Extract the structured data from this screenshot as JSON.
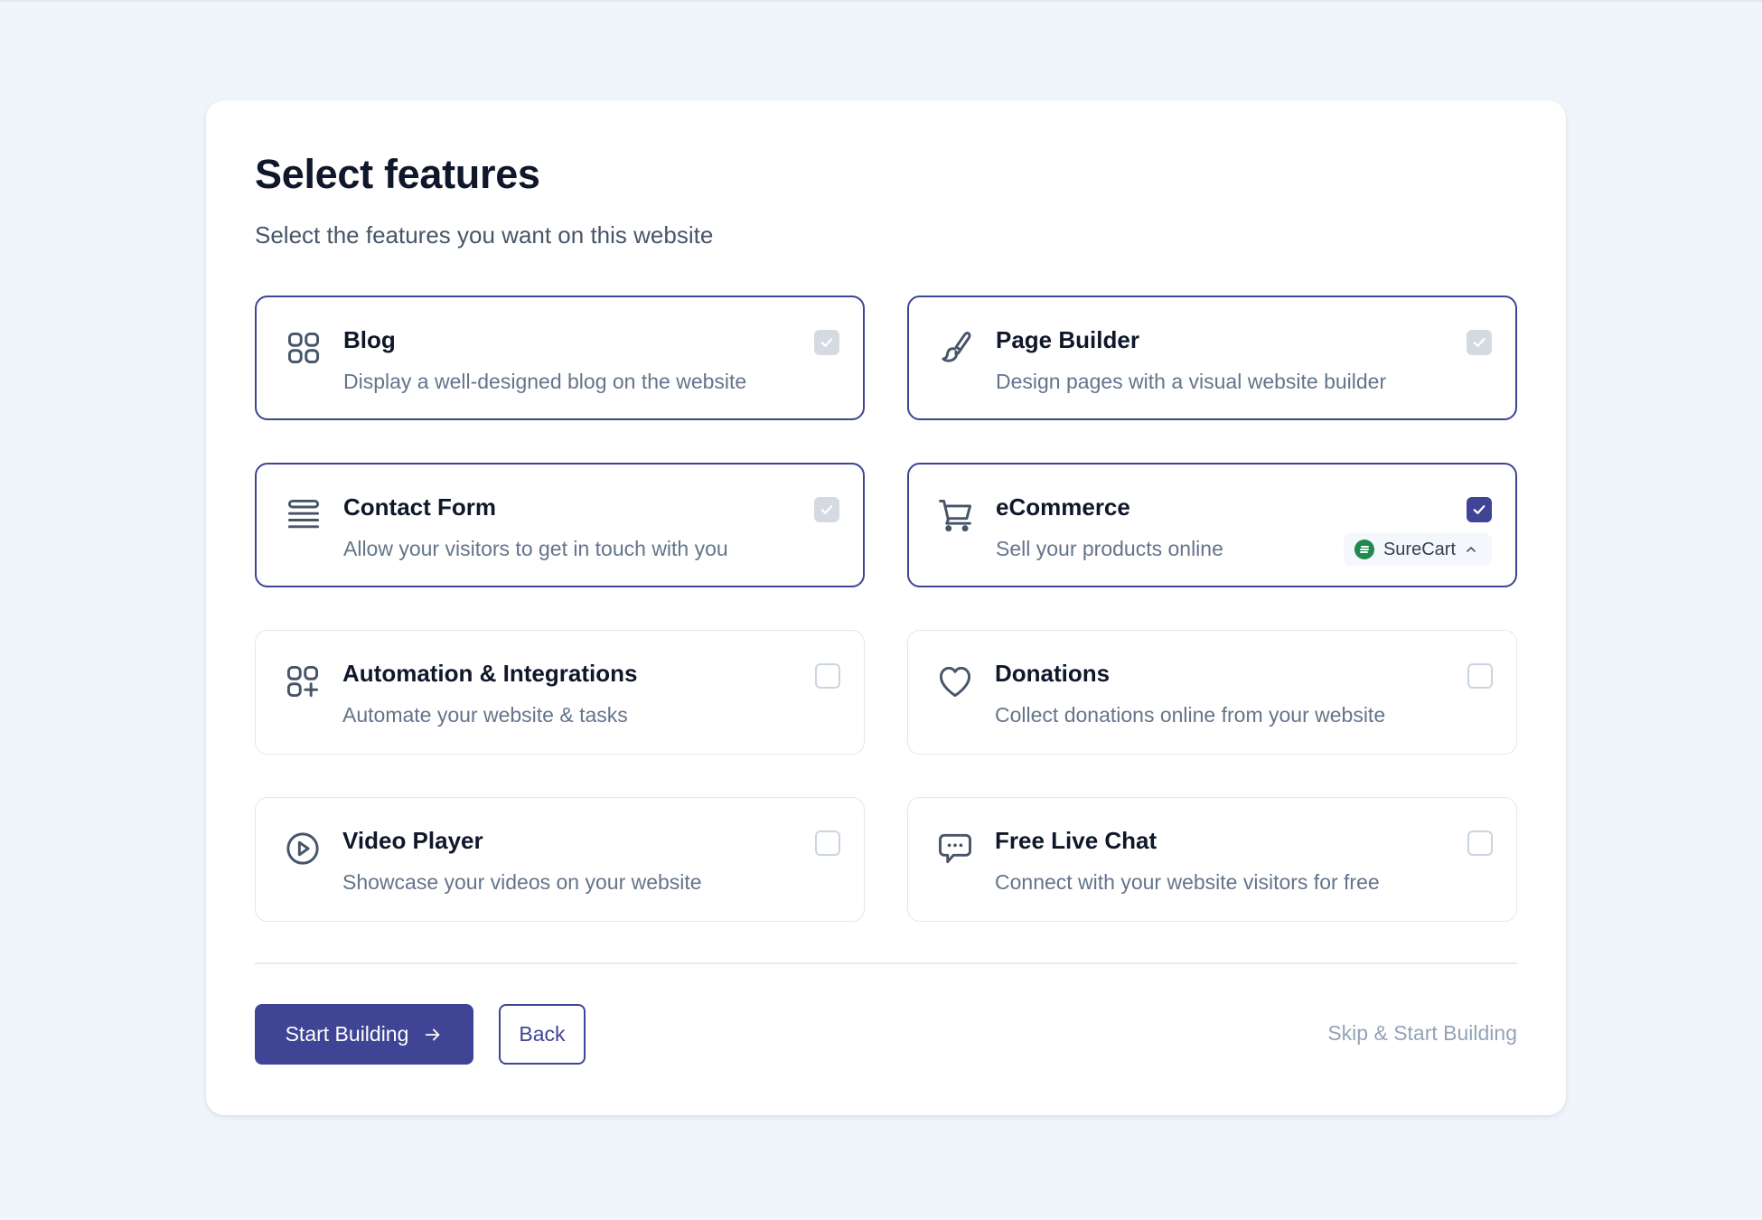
{
  "header": {
    "title": "Select features",
    "subtitle": "Select the features you want on this website"
  },
  "features": [
    {
      "name": "Blog",
      "description": "Display a well-designed blog on the website",
      "icon": "grid-icon",
      "state": "checked-locked"
    },
    {
      "name": "Page Builder",
      "description": "Design pages with a visual website builder",
      "icon": "paintbrush-icon",
      "state": "checked-locked"
    },
    {
      "name": "Contact Form",
      "description": "Allow your visitors to get in touch with you",
      "icon": "form-lines-icon",
      "state": "checked-locked"
    },
    {
      "name": "eCommerce",
      "description": "Sell your products online",
      "icon": "shopping-cart-icon",
      "state": "checked",
      "plugin": {
        "label": "SureCart",
        "icon": "surecart-logo-icon",
        "toggle_icon": "chevron-up-icon"
      }
    },
    {
      "name": "Automation & Integrations",
      "description": "Automate your website & tasks",
      "icon": "grid-plus-icon",
      "state": "unchecked"
    },
    {
      "name": "Donations",
      "description": "Collect donations online from your website",
      "icon": "heart-icon",
      "state": "unchecked"
    },
    {
      "name": "Video Player",
      "description": "Showcase your videos on your website",
      "icon": "play-circle-icon",
      "state": "unchecked"
    },
    {
      "name": "Free Live Chat",
      "description": "Connect with your website visitors for free",
      "icon": "chat-bubble-icon",
      "state": "unchecked"
    }
  ],
  "footer": {
    "primary_label": "Start Building",
    "primary_icon": "arrow-right-icon",
    "back_label": "Back",
    "skip_label": "Skip & Start Building"
  },
  "colors": {
    "accent": "#3f4494",
    "background": "#f0f4fb",
    "surecart_green": "#1f8a4c",
    "locked_check": "#d5dae2"
  }
}
